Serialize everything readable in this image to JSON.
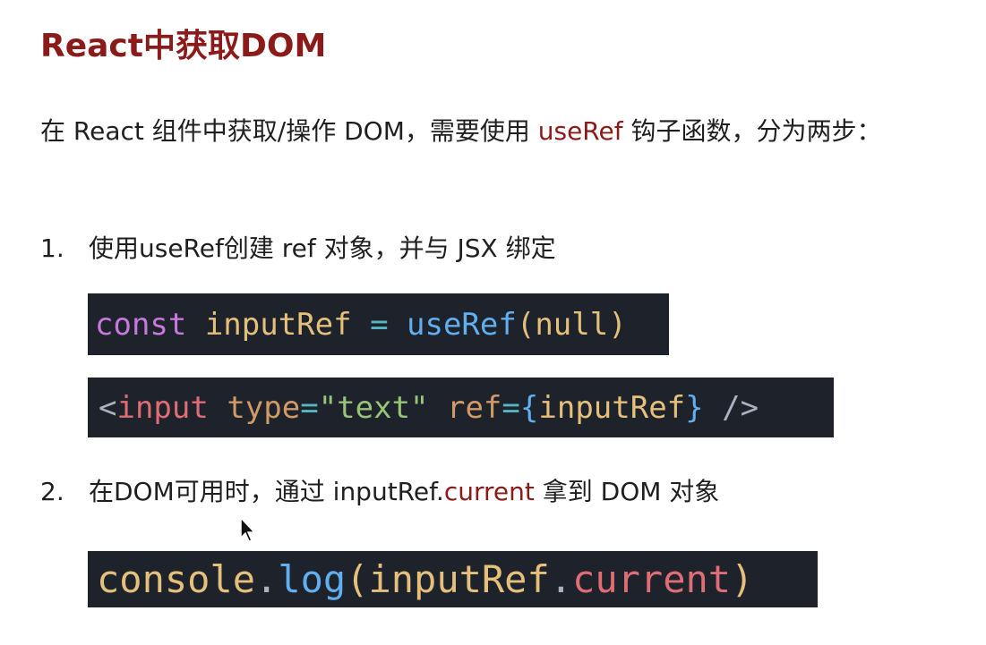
{
  "title": "React中获取DOM",
  "intro": {
    "before": "在 React 组件中获取/操作 DOM，需要使用 ",
    "highlight": "useRef",
    "after": " 钩子函数，分为两步："
  },
  "steps": [
    {
      "number": "1.",
      "text": "使用useRef创建 ref 对象，并与 JSX 绑定"
    },
    {
      "number": "2.",
      "before": "在DOM可用时，通过 inputRef.",
      "highlight": "current",
      "after": " 拿到 DOM 对象"
    }
  ],
  "code": {
    "line1": {
      "t1": "const",
      "t2": " inputRef",
      "t3": " = ",
      "t4": "useRef",
      "t5": "(",
      "t6": "null",
      "t7": ")"
    },
    "line2": {
      "t1": "<",
      "t2": "input",
      "t3": " type",
      "t4": "=",
      "t5": "\"text\"",
      "t6": " ref",
      "t7": "=",
      "t8": "{",
      "t9": "inputRef",
      "t10": "}",
      "t11": " />"
    },
    "line3": {
      "t1": "console",
      "t2": ".",
      "t3": "log",
      "t4": "(",
      "t5": "inputRef",
      "t6": ".",
      "t7": "current",
      "t8": ")"
    }
  },
  "colors": {
    "accent": "#8b1a1a",
    "code_background": "#1e222b"
  },
  "icons": {
    "cursor": "mouse-pointer-icon"
  }
}
